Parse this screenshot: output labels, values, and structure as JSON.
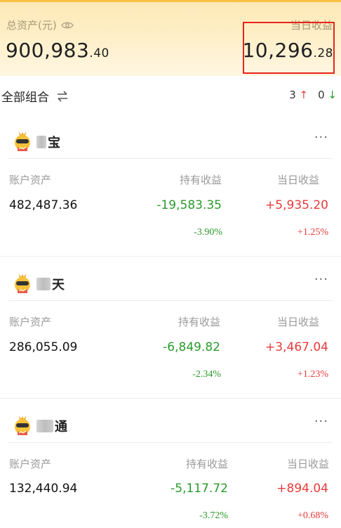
{
  "summary": {
    "total_label": "总资产(元)",
    "total_int": "900,983",
    "total_dec": ".40",
    "today_label": "当日收益",
    "today_int": "10,296",
    "today_dec": ".28"
  },
  "group": {
    "title": "全部组合",
    "up_count": "3",
    "down_count": "0"
  },
  "columns": {
    "assets": "账户资产",
    "holding": "持有收益",
    "today": "当日收益"
  },
  "cards": [
    {
      "name": "宝",
      "assets": "482,487.36",
      "holding": "-19,583.35",
      "holding_pct": "-3.90%",
      "today": "+5,935.20",
      "today_pct": "+1.25%"
    },
    {
      "name": "天",
      "assets": "286,055.09",
      "holding": "-6,849.82",
      "holding_pct": "-2.34%",
      "today": "+3,467.04",
      "today_pct": "+1.23%"
    },
    {
      "name": "通",
      "assets": "132,440.94",
      "holding": "-5,117.72",
      "holding_pct": "-3.72%",
      "today": "+894.04",
      "today_pct": "+0.68%"
    }
  ],
  "colors": {
    "up": "#e83a3a",
    "down": "#2a9a2a",
    "highlight_box": "#e8241b"
  },
  "icons": {
    "eye": "eye-icon",
    "swap": "swap-icon",
    "more": "more-icon",
    "mascot": "mascot-icon"
  }
}
